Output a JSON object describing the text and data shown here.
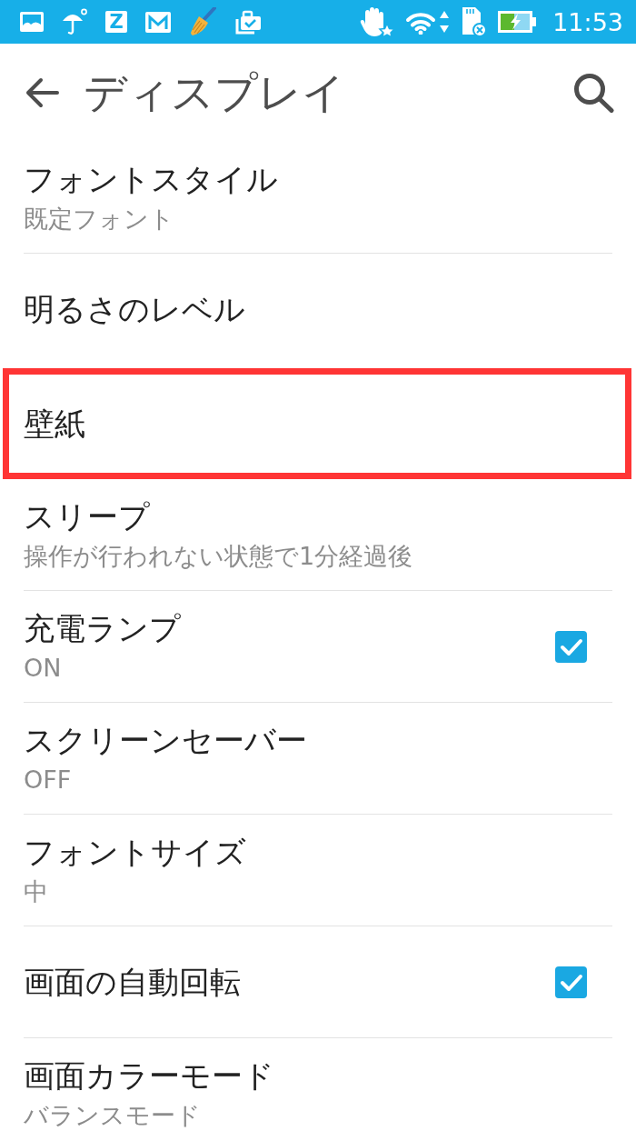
{
  "status_bar": {
    "app_letter": "Z",
    "time": "11:53"
  },
  "toolbar": {
    "title": "ディスプレイ"
  },
  "settings": [
    {
      "kind": "text",
      "title": "フォントスタイル",
      "summary": "既定フォント",
      "highlighted": false
    },
    {
      "kind": "text",
      "title": "明るさのレベル",
      "highlighted": false
    },
    {
      "kind": "text",
      "title": "壁紙",
      "highlighted": true
    },
    {
      "kind": "text",
      "title": "スリープ",
      "summary": "操作が行われない状態で1分経過後",
      "highlighted": false
    },
    {
      "kind": "checkbox",
      "title": "充電ランプ",
      "summary": "ON",
      "checked": true,
      "highlighted": false
    },
    {
      "kind": "text",
      "title": "スクリーンセーバー",
      "summary": "OFF",
      "highlighted": false
    },
    {
      "kind": "text",
      "title": "フォントサイズ",
      "summary": "中",
      "highlighted": false
    },
    {
      "kind": "checkbox",
      "title": "画面の自動回転",
      "checked": true,
      "highlighted": false
    },
    {
      "kind": "text",
      "title": "画面カラーモード",
      "summary": "バランスモード",
      "highlighted": false
    }
  ]
}
